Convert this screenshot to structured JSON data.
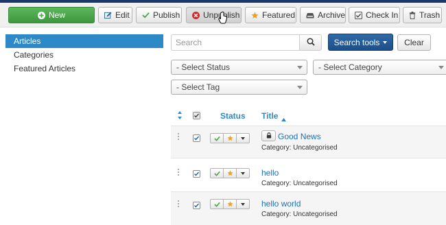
{
  "toolbar": {
    "buttons": [
      {
        "label": "New",
        "icon": "plus-circle-icon"
      },
      {
        "label": "Edit",
        "icon": "edit-icon"
      },
      {
        "label": "Publish",
        "icon": "check-icon"
      },
      {
        "label": "Unpublish",
        "icon": "times-circle-icon"
      },
      {
        "label": "Featured",
        "icon": "star-icon"
      },
      {
        "label": "Archive",
        "icon": "archive-icon"
      },
      {
        "label": "Check In",
        "icon": "checkbox-icon"
      },
      {
        "label": "Trash",
        "icon": "trash-icon"
      }
    ]
  },
  "sidebar": {
    "items": [
      {
        "label": "Articles",
        "active": true
      },
      {
        "label": "Categories",
        "active": false
      },
      {
        "label": "Featured Articles",
        "active": false
      }
    ]
  },
  "search": {
    "placeholder": "Search",
    "tools_label": "Search tools",
    "clear_label": "Clear"
  },
  "filters": {
    "status": "- Select Status",
    "category": "- Select Category",
    "tag": "- Select Tag"
  },
  "table": {
    "headers": {
      "status": "Status",
      "title": "Title"
    },
    "rows": [
      {
        "title": "Good News",
        "category": "Category: Uncategorised",
        "locked": true
      },
      {
        "title": "hello",
        "category": "Category: Uncategorised",
        "locked": false
      },
      {
        "title": "hello world",
        "category": "Category: Uncategorised",
        "locked": false
      }
    ]
  },
  "colors": {
    "accent": "#2d8ac7",
    "new_button": "#4cae4c",
    "search_tools_button": "#245b96",
    "published_check": "#51a351",
    "featured_star": "#f0a020",
    "unpublish_icon": "#c9302c"
  }
}
